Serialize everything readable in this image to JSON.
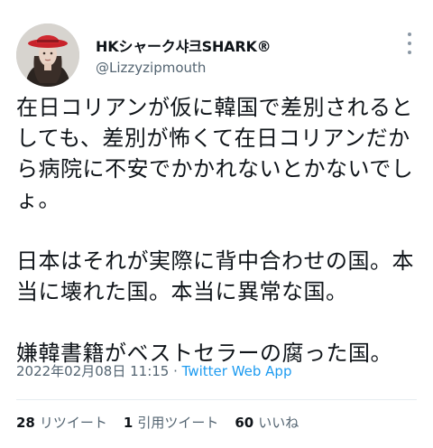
{
  "author": {
    "display_name": "HKシャーク샤크SHARK®",
    "handle": "@Lizzyzipmouth"
  },
  "icons": {
    "more": "more-vertical-icon",
    "avatar": "profile-photo"
  },
  "tweet": {
    "text": "在日コリアンが仮に韓国で差別されるとしても、差別が怖くて在日コリアンだから病院に不安でかかれないとかないでしょ。\n\n日本はそれが実際に背中合わせの国。本当に壊れた国。本当に異常な国。\n\n嫌韓書籍がベストセラーの腐った国。",
    "timestamp": "2022年02月08日 11:15",
    "separator": " · ",
    "source_app": "Twitter Web App"
  },
  "stats": {
    "retweets": {
      "count": "28",
      "label": "リツイート"
    },
    "quotes": {
      "count": "1",
      "label": "引用ツイート"
    },
    "likes": {
      "count": "60",
      "label": "いいね"
    }
  },
  "colors": {
    "link": "#1d9bf0",
    "muted": "#536471",
    "text": "#0f1419"
  }
}
